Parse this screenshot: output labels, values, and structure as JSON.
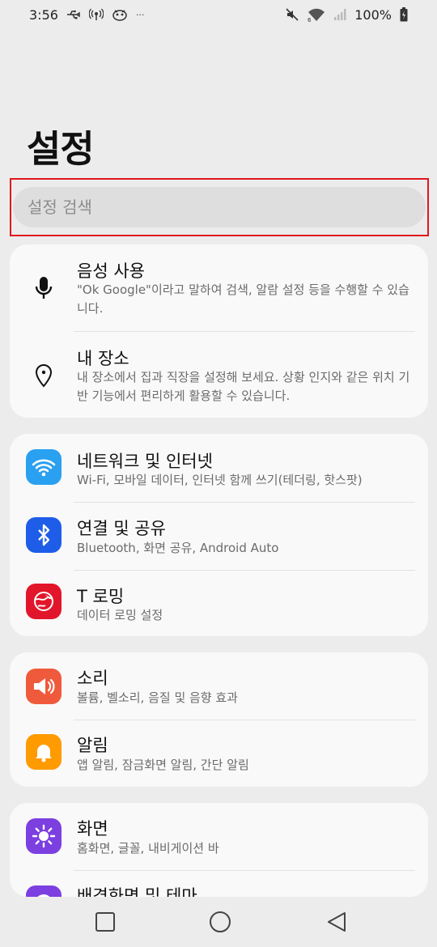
{
  "status": {
    "time": "3:56",
    "overflow": "···",
    "battery": "100%"
  },
  "page": {
    "title": "설정"
  },
  "search": {
    "placeholder": "설정 검색"
  },
  "colors": {
    "accent_red": "#e0161e",
    "network": "#2aa0f0",
    "bluetooth": "#1e5de8",
    "troaming": "#e2162a",
    "sound": "#f05a3c",
    "notification": "#ff9a00",
    "display": "#7c3fe0"
  },
  "cards": [
    {
      "items": [
        {
          "icon": "microphone-icon",
          "title": "음성 사용",
          "subtitle": "\"Ok Google\"이라고 말하여 검색, 알람 설정 등을 수행할 수 있습니다."
        },
        {
          "icon": "location-pin-icon",
          "title": "내 장소",
          "subtitle": "내 장소에서 집과 직장을 설정해 보세요. 상황 인지와 같은 위치 기반 기능에서 편리하게 활용할 수 있습니다."
        }
      ]
    },
    {
      "items": [
        {
          "icon": "wifi-icon",
          "title": "네트워크 및 인터넷",
          "subtitle": "Wi-Fi, 모바일 데이터, 인터넷 함께 쓰기(테더링, 핫스팟)"
        },
        {
          "icon": "bluetooth-icon",
          "title": "연결 및 공유",
          "subtitle": "Bluetooth, 화면 공유, Android Auto"
        },
        {
          "icon": "t-roaming-icon",
          "title": "T 로밍",
          "subtitle": "데이터 로밍 설정"
        }
      ]
    },
    {
      "items": [
        {
          "icon": "speaker-icon",
          "title": "소리",
          "subtitle": "볼륨, 벨소리, 음질 및 음향 효과"
        },
        {
          "icon": "bell-icon",
          "title": "알림",
          "subtitle": "앱 알림, 잠금화면 알림, 간단 알림"
        }
      ]
    },
    {
      "items": [
        {
          "icon": "sun-icon",
          "title": "화면",
          "subtitle": "홈화면, 글꼴, 내비게이션 바"
        },
        {
          "icon": "palette-icon",
          "title": "배경화면 및 테마",
          "subtitle": ""
        }
      ]
    }
  ]
}
